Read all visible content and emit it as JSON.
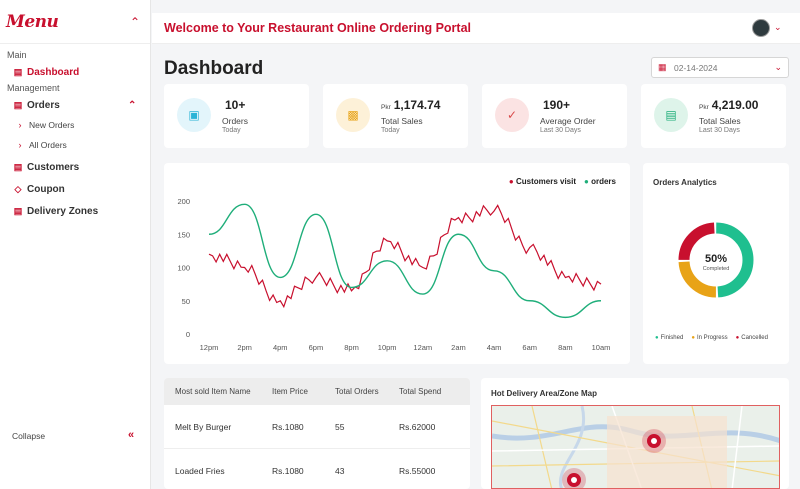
{
  "sidebar": {
    "logo": "Menu",
    "section_main": "Main",
    "dashboard": "Dashboard",
    "section_management": "Management",
    "orders": "Orders",
    "new_orders": "New Orders",
    "all_orders": "All Orders",
    "customers": "Customers",
    "coupon": "Coupon",
    "delivery_zones": "Delivery Zones",
    "collapse": "Collapse"
  },
  "header": {
    "title": "Welcome to Your Restaurant Online Ordering Portal"
  },
  "page": {
    "title": "Dashboard",
    "date": "02-14-2024"
  },
  "stats": [
    {
      "value": "10+",
      "currency": "",
      "label": "Orders",
      "sub": "Today",
      "icon": "basket-icon",
      "color": "#2bb3d6",
      "bg": "#e3f5fb"
    },
    {
      "value": "1,174.74",
      "currency": "Pkr",
      "label": "Total Sales",
      "sub": "Today",
      "icon": "bar-chart-icon",
      "color": "#e8a317",
      "bg": "#fdf1d8"
    },
    {
      "value": "190+",
      "currency": "",
      "label": "Average Order",
      "sub": "Last 30 Days",
      "icon": "cart-icon",
      "color": "#d94a4a",
      "bg": "#fbe3e3"
    },
    {
      "value": "4,219.00",
      "currency": "Pkr",
      "label": "Total Sales",
      "sub": "Last 30 Days",
      "icon": "money-icon",
      "color": "#1fae7a",
      "bg": "#def4ea"
    }
  ],
  "chart_data": {
    "type": "line",
    "x": [
      "12pm",
      "2pm",
      "4pm",
      "6pm",
      "8pm",
      "10pm",
      "12am",
      "2am",
      "4am",
      "6am",
      "8am",
      "10am"
    ],
    "ylim": [
      0,
      200
    ],
    "yticks": [
      0,
      50,
      100,
      150,
      200
    ],
    "series": [
      {
        "name": "Customers visit",
        "color": "#c8102e",
        "values": [
          120,
          100,
          50,
          85,
          65,
          140,
          100,
          175,
          185,
          130,
          85,
          75
        ]
      },
      {
        "name": "orders",
        "color": "#1fae7a",
        "values": [
          150,
          195,
          85,
          180,
          70,
          110,
          60,
          150,
          95,
          50,
          25,
          50
        ]
      }
    ]
  },
  "donut": {
    "title": "Orders Analytics",
    "center_value": "50%",
    "center_label": "Completed",
    "segments": [
      {
        "name": "Finished",
        "value": 50,
        "color": "#1fbf8f"
      },
      {
        "name": "In Progress",
        "value": 25,
        "color": "#e8a317"
      },
      {
        "name": "Cancelled",
        "value": 25,
        "color": "#c8102e"
      }
    ]
  },
  "table": {
    "headers": [
      "Most sold Item Name",
      "Item Price",
      "Total Orders",
      "Total Spend"
    ],
    "rows": [
      [
        "Melt By Burger",
        "Rs.1080",
        "55",
        "Rs.62000"
      ],
      [
        "Loaded Fries",
        "Rs.1080",
        "43",
        "Rs.55000"
      ]
    ]
  },
  "map": {
    "title": "Hot Delivery Area/Zone Map"
  }
}
